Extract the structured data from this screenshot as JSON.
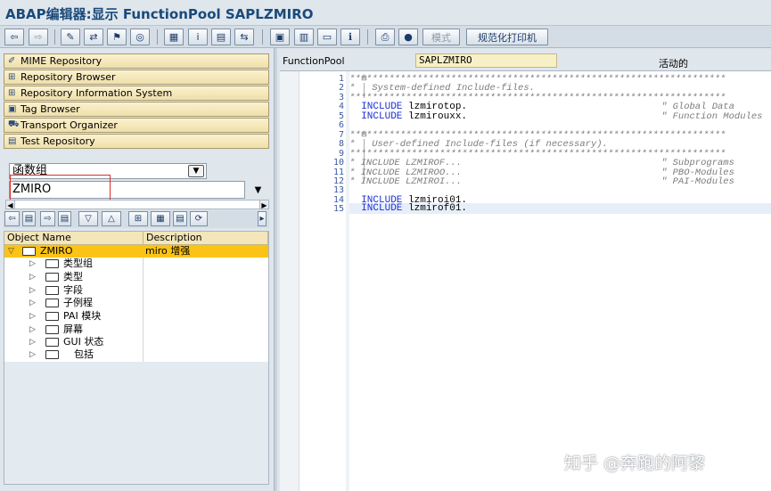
{
  "window": {
    "title": "ABAP编辑器:显示 FunctionPool SAPLZMIRO"
  },
  "toolbar": {
    "icons": [
      "back-arrow-icon",
      "forward-arrow-icon",
      "toggle-edit-icon",
      "other-object-icon",
      "activate-icon",
      "where-used-icon",
      "display-object-list-icon",
      "info-icon",
      "program-object-icon",
      "navigation-window-icon",
      "layout-icon",
      "split-screen-icon",
      "help-icon",
      "settings-icon",
      "pretty-printer-icon"
    ],
    "mode_label": "模式",
    "pretty_printer_label": "规范化打印机"
  },
  "navigator": {
    "buttons": [
      {
        "label": "MIME Repository",
        "icon": "mime-icon"
      },
      {
        "label": "Repository Browser",
        "icon": "repository-browser-icon"
      },
      {
        "label": "Repository Information System",
        "icon": "repository-info-icon"
      },
      {
        "label": "Tag Browser",
        "icon": "tag-icon"
      },
      {
        "label": "Transport Organizer",
        "icon": "transport-icon"
      },
      {
        "label": "Test Repository",
        "icon": "test-icon"
      }
    ],
    "object_type": "函数组",
    "object_name": "ZMIRO"
  },
  "tree": {
    "columns": [
      "Object Name",
      "Description"
    ],
    "root": {
      "name": "ZMIRO",
      "description": "miro 增强"
    },
    "children": [
      "类型组",
      "类型",
      "字段",
      "子例程",
      "PAI 模块",
      "屏幕",
      "GUI 状态",
      "包括"
    ]
  },
  "editor": {
    "header_label": "FunctionPool",
    "program": "SAPLZMIRO",
    "status": "活动的",
    "line_numbers": [
      "1",
      "2",
      "3",
      "4",
      "5",
      "6",
      "7",
      "8",
      "9",
      "10",
      "11",
      "12",
      "13",
      "14",
      "15"
    ],
    "lines": [
      {
        "type": "comment",
        "text": "*******************************************************************"
      },
      {
        "type": "comment",
        "text": "*   System-defined Include-files."
      },
      {
        "type": "comment",
        "text": "*******************************************************************"
      },
      {
        "type": "include",
        "keyword": "INCLUDE",
        "name": "lzmirotop.",
        "comment": "\" Global Data"
      },
      {
        "type": "include",
        "keyword": "INCLUDE",
        "name": "lzmirouxx.",
        "comment": "\" Function Modules"
      },
      {
        "type": "blank",
        "text": ""
      },
      {
        "type": "comment",
        "text": "*******************************************************************"
      },
      {
        "type": "comment",
        "text": "*   User-defined Include-files (if necessary)."
      },
      {
        "type": "comment",
        "text": "*******************************************************************"
      },
      {
        "type": "comment",
        "text": "* INCLUDE LZMIROF...",
        "comment": "\" Subprograms"
      },
      {
        "type": "comment",
        "text": "* INCLUDE LZMIROO...",
        "comment": "\" PBO-Modules"
      },
      {
        "type": "comment",
        "text": "* INCLUDE LZMIROI...",
        "comment": "\" PAI-Modules"
      },
      {
        "type": "blank",
        "text": ""
      },
      {
        "type": "include",
        "keyword": "INCLUDE",
        "name": "lzmiroi01."
      },
      {
        "type": "include",
        "keyword": "INCLUDE",
        "name": "lzmirof01."
      }
    ]
  },
  "watermark": "知乎 @奔跑的阿黎"
}
